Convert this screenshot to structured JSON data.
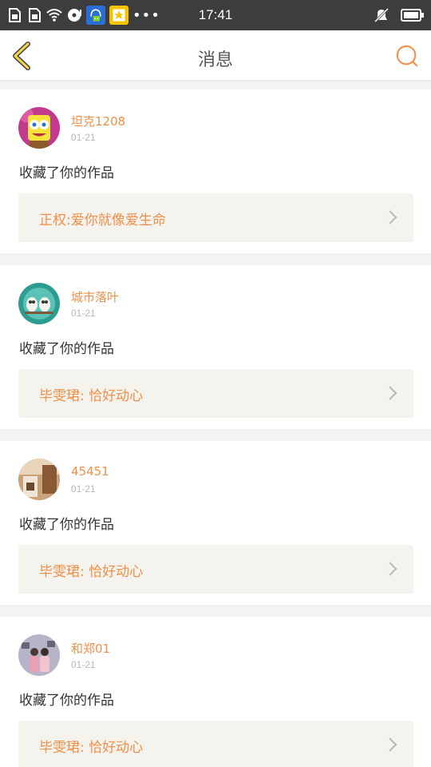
{
  "status_bar": {
    "time": "17:41",
    "dots": "•••",
    "icons": [
      "sim-card-icon",
      "sim-card-icon",
      "wifi-icon",
      "disc-icon",
      "qq-app-icon",
      "favorites-app-icon",
      "mute-icon",
      "battery-icon"
    ]
  },
  "header": {
    "title": "消息",
    "back_icon": "chevron-left-icon",
    "search_icon": "search-icon"
  },
  "colors": {
    "accent": "#f0904a",
    "back_arrow": "#f2d54e",
    "status_bar": "#3d3d3d",
    "work_box": "#f4f3ed"
  },
  "messages": [
    {
      "username": "坦克1208",
      "date": "01-21",
      "action": "收藏了你的作品",
      "work_title": "正权:爱你就像爱生命",
      "avatar": "spongebob-avatar"
    },
    {
      "username": "城市落叶",
      "date": "01-21",
      "action": "收藏了你的作品",
      "work_title": "毕雯珺: 恰好动心",
      "avatar": "owls-avatar"
    },
    {
      "username": "45451",
      "date": "01-21",
      "action": "收藏了你的作品",
      "work_title": "毕雯珺: 恰好动心",
      "avatar": "room-avatar"
    },
    {
      "username": "和郑01",
      "date": "01-21",
      "action": "收藏了你的作品",
      "work_title": "毕雯珺: 恰好动心",
      "avatar": "people-avatar"
    }
  ]
}
